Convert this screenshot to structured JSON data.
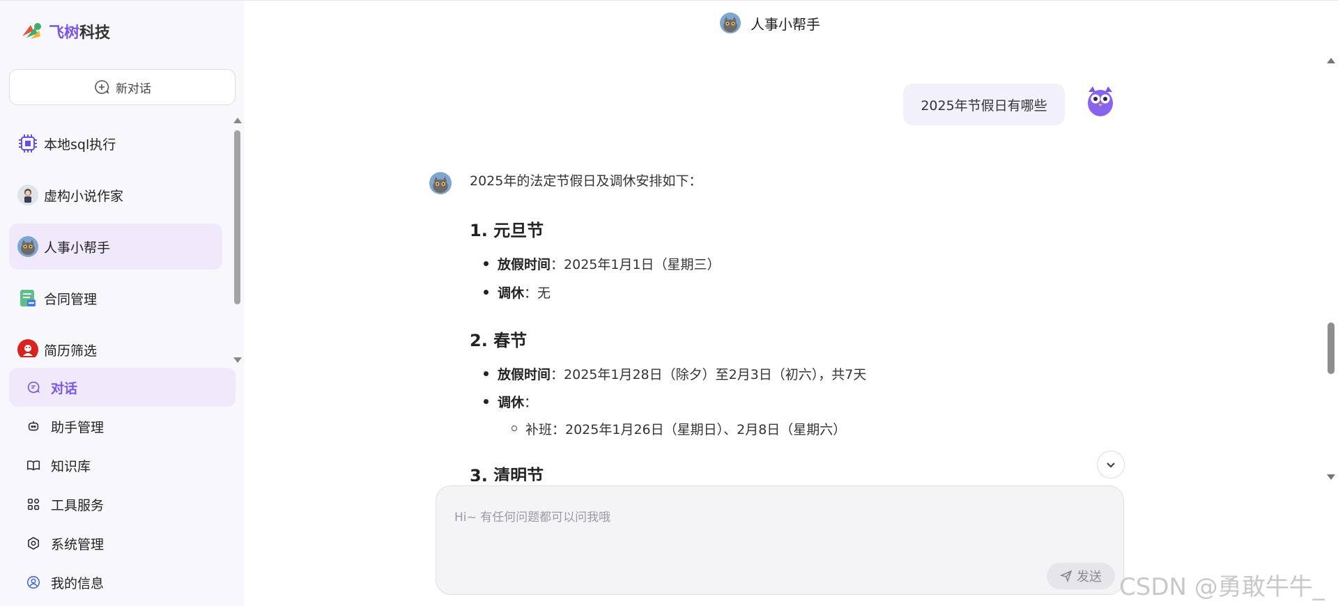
{
  "brand": {
    "name_a": "飞树",
    "name_b": "科技"
  },
  "new_chat": {
    "label": "新对话"
  },
  "assistants": [
    {
      "label": "本地sql执行",
      "icon": "chip-icon"
    },
    {
      "label": "虚构小说作家",
      "icon": "writer-avatar"
    },
    {
      "label": "人事小帮手",
      "icon": "owl-cat-avatar",
      "active": true
    },
    {
      "label": "合同管理",
      "icon": "contract-icon"
    },
    {
      "label": "简历筛选",
      "icon": "resume-icon"
    }
  ],
  "nav": [
    {
      "label": "对话",
      "icon": "chat-icon",
      "active": true
    },
    {
      "label": "助手管理",
      "icon": "bot-icon"
    },
    {
      "label": "知识库",
      "icon": "book-icon"
    },
    {
      "label": "工具服务",
      "icon": "apps-icon"
    },
    {
      "label": "系统管理",
      "icon": "hexagon-settings-icon"
    },
    {
      "label": "我的信息",
      "icon": "user-icon"
    }
  ],
  "header": {
    "title": "人事小帮手"
  },
  "conversation": {
    "user_message": "2025年节假日有哪些",
    "answer": {
      "intro": "2025年的法定节假日及调休安排如下：",
      "sections": [
        {
          "title": "1. 元旦节",
          "items": [
            {
              "key": "放假时间",
              "value": "：2025年1月1日（星期三）"
            },
            {
              "key": "调休",
              "value": "：无"
            }
          ]
        },
        {
          "title": "2. 春节",
          "items": [
            {
              "key": "放假时间",
              "value": "：2025年1月28日（除夕）至2月3日（初六），共7天"
            },
            {
              "key": "调休",
              "value": "："
            }
          ],
          "subitems": [
            "补班：2025年1月26日（星期日）、2月8日（星期六）"
          ]
        },
        {
          "title": "3. 清明节"
        }
      ]
    }
  },
  "input": {
    "placeholder": "Hi~ 有任何问题都可以问我哦",
    "value": ""
  },
  "send": {
    "label": "发送"
  },
  "watermark": "CSDN @勇敢牛牛_",
  "colors": {
    "accent": "#7a55e6",
    "active_bg": "#efe9fb",
    "sidebar_bg": "#f8f7fc"
  }
}
